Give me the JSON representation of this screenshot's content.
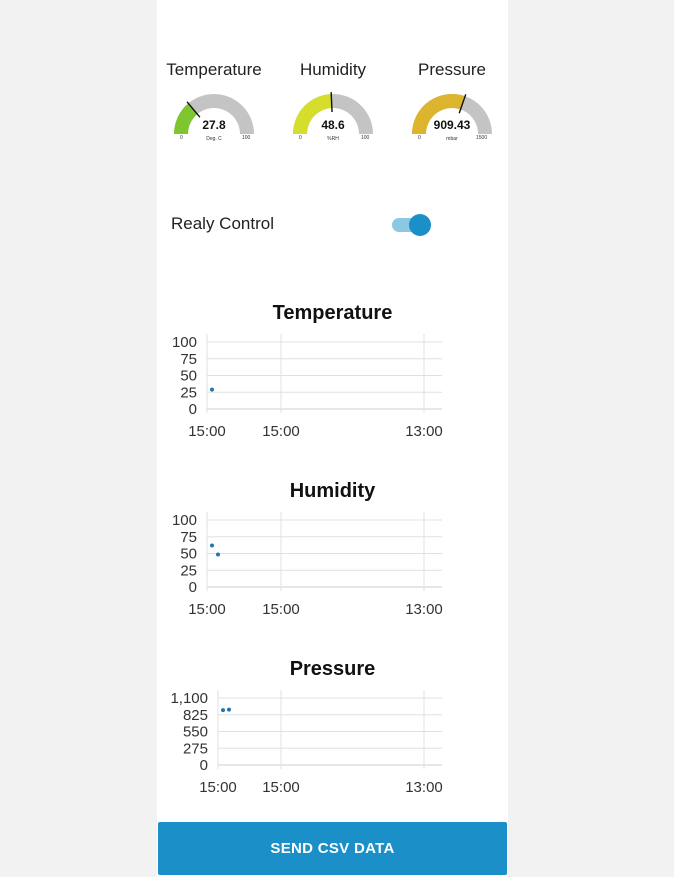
{
  "colors": {
    "panel_bg": "#ffffff",
    "page_bg": "#f2f2f2",
    "accent": "#1a8fc8",
    "gauge_track": "#c4c4c4",
    "grid": "#e0e0e0",
    "point": "#1f77b4"
  },
  "gauges": [
    {
      "title": "Temperature",
      "value": 27.8,
      "value_text": "27.8",
      "unit": "Deg. C",
      "min": 0,
      "max": 100,
      "min_text": "0",
      "max_text": "100",
      "color": "#7dc62f"
    },
    {
      "title": "Humidity",
      "value": 48.6,
      "value_text": "48.6",
      "unit": "%RH",
      "min": 0,
      "max": 100,
      "min_text": "0",
      "max_text": "100",
      "color": "#d4de2b"
    },
    {
      "title": "Pressure",
      "value": 909.43,
      "value_text": "909.43",
      "unit": "mbar",
      "min": 0,
      "max": 1500,
      "min_text": "0",
      "max_text": "1500",
      "color": "#dcb42d"
    }
  ],
  "relay": {
    "label": "Realy Control",
    "state": true
  },
  "send_button": {
    "label": "SEND CSV DATA"
  },
  "chart_data": [
    {
      "type": "scatter",
      "title": "Temperature",
      "ylim": [
        0,
        100
      ],
      "yticks": [
        0,
        25,
        50,
        75,
        100
      ],
      "ytick_labels": [
        "0",
        "25",
        "50",
        "75",
        "100"
      ],
      "xtick_labels": [
        "15:00",
        "15:00",
        "13:00"
      ],
      "grid": true,
      "points": [
        {
          "x": "15:00",
          "y": 29
        }
      ]
    },
    {
      "type": "scatter",
      "title": "Humidity",
      "ylim": [
        0,
        100
      ],
      "yticks": [
        0,
        25,
        50,
        75,
        100
      ],
      "ytick_labels": [
        "0",
        "25",
        "50",
        "75",
        "100"
      ],
      "xtick_labels": [
        "15:00",
        "15:00",
        "13:00"
      ],
      "grid": true,
      "points": [
        {
          "x": "15:00",
          "y": 62
        },
        {
          "x": "15:00",
          "y": 48.6
        }
      ]
    },
    {
      "type": "scatter",
      "title": "Pressure",
      "ylim": [
        0,
        1100
      ],
      "yticks": [
        0,
        275,
        550,
        825,
        1100
      ],
      "ytick_labels": [
        "0",
        "275",
        "550",
        "825",
        "1,100"
      ],
      "xtick_labels": [
        "15:00",
        "15:00",
        "13:00"
      ],
      "grid": true,
      "points": [
        {
          "x": "15:00",
          "y": 900
        },
        {
          "x": "15:00",
          "y": 910
        }
      ]
    }
  ]
}
